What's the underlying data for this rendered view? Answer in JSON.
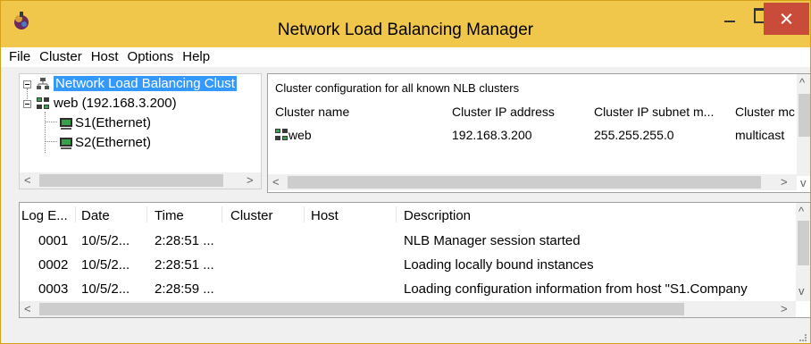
{
  "window": {
    "title": "Network Load Balancing Manager"
  },
  "menu": [
    "File",
    "Cluster",
    "Host",
    "Options",
    "Help"
  ],
  "tree": {
    "root_label": "Network Load Balancing Clust",
    "cluster_label": "web (192.168.3.200)",
    "hosts": [
      "S1(Ethernet)",
      "S2(Ethernet)"
    ]
  },
  "cluster_panel": {
    "caption": "Cluster configuration for all known NLB clusters",
    "columns": [
      "Cluster name",
      "Cluster IP address",
      "Cluster IP subnet m...",
      "Cluster mc"
    ],
    "rows": [
      [
        "web",
        "192.168.3.200",
        "255.255.255.0",
        "multicast"
      ]
    ]
  },
  "log": {
    "columns": [
      "Log E...",
      "Date",
      "Time",
      "Cluster",
      "Host",
      "Description"
    ],
    "rows": [
      [
        "0001",
        "10/5/2...",
        "2:28:51 ...",
        "",
        "",
        "NLB Manager session started"
      ],
      [
        "0002",
        "10/5/2...",
        "2:28:51 ...",
        "",
        "",
        "Loading locally bound instances"
      ],
      [
        "0003",
        "10/5/2...",
        "2:28:59 ...",
        "",
        "",
        "Loading configuration information from host \"S1.Company"
      ]
    ]
  },
  "colors": {
    "titlebar": "#f0c74a",
    "close_button": "#c94b3a",
    "selection": "#3399ff"
  }
}
